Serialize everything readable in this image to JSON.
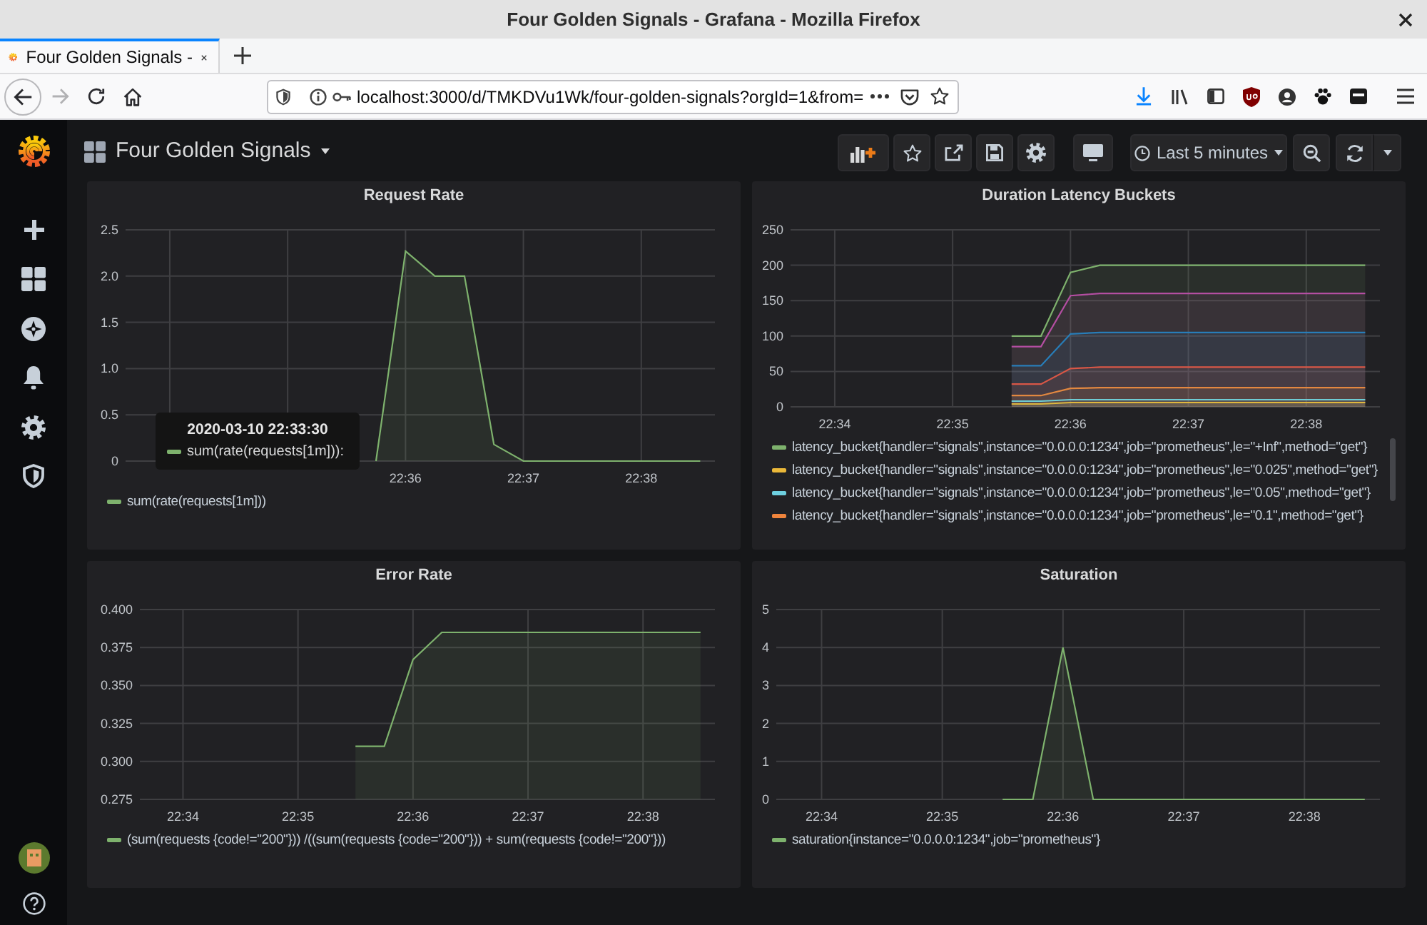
{
  "window": {
    "title": "Four Golden Signals - Grafana - Mozilla Firefox"
  },
  "browser": {
    "tabs": [
      {
        "label": "Four Golden Signals -",
        "selected": true
      }
    ],
    "forward_disabled": true,
    "url": "localhost:3000/d/TMKDVu1Wk/four-golden-signals?orgId=1&from="
  },
  "dashboard": {
    "title": "Four Golden Signals",
    "time_range": "Last 5 minutes"
  },
  "panels": [
    {
      "chart_data": {
        "type": "area",
        "title": "Request Rate",
        "grid": true,
        "categories": [
          null,
          null,
          null,
          null,
          null,
          null,
          null,
          null,
          null,
          "22:36",
          null,
          null,
          null,
          "22:37",
          null,
          null,
          null,
          "22:38",
          null,
          null
        ],
        "series": [
          {
            "name": "sum(rate(requests[1m]))",
            "color": "#7eb26d",
            "values": [
              null,
              null,
              null,
              null,
              null,
              null,
              null,
              null,
              0,
              2.27,
              2,
              2,
              0.18,
              0,
              0,
              0,
              0,
              0,
              0,
              0
            ]
          }
        ],
        "ylim": [
          0,
          2.5
        ],
        "yticks": [
          0,
          0.5,
          {
            "value": 1,
            "label": "1.0"
          },
          1.5,
          {
            "value": 2,
            "label": "2.0"
          },
          2.5
        ]
      },
      "tooltip": {
        "time": "2020-03-10 22:33:30",
        "items": [
          "sum(rate(requests[1m])):"
        ]
      }
    },
    {
      "chart_data": {
        "type": "area",
        "title": "Duration Latency Buckets",
        "grid": true,
        "categories": [
          null,
          "22:34",
          null,
          null,
          null,
          "22:35",
          null,
          null,
          null,
          "22:36",
          null,
          null,
          null,
          "22:37",
          null,
          null,
          null,
          "22:38",
          null,
          null
        ],
        "series": [
          {
            "name": "latency_bucket{handler=\"signals\",instance=\"0.0.0.0:1234\",job=\"prometheus\",le=\"+Inf\",method=\"get\"}",
            "color": "#7eb26d",
            "values": [
              null,
              null,
              null,
              null,
              null,
              null,
              null,
              100,
              100,
              190,
              200,
              200,
              200,
              200,
              200,
              200,
              200,
              200,
              200,
              200
            ]
          },
          {
            "name": "latency_bucket{handler=\"signals\",instance=\"0.0.0.0:1234\",job=\"prometheus\",le=\"0.025\",method=\"get\"}",
            "color": "#eab839",
            "values": [
              null,
              null,
              null,
              null,
              null,
              null,
              null,
              4,
              4,
              6,
              6,
              6,
              6,
              6,
              6,
              6,
              6,
              6,
              6,
              6
            ]
          },
          {
            "name": "latency_bucket{handler=\"signals\",instance=\"0.0.0.0:1234\",job=\"prometheus\",le=\"0.05\",method=\"get\"}",
            "color": "#6ed0e0",
            "values": [
              null,
              null,
              null,
              null,
              null,
              null,
              null,
              8,
              8,
              10,
              10,
              10,
              10,
              10,
              10,
              10,
              10,
              10,
              10,
              10
            ]
          },
          {
            "name": "latency_bucket{handler=\"signals\",instance=\"0.0.0.0:1234\",job=\"prometheus\",le=\"0.1\",method=\"get\"}",
            "color": "#ef843c",
            "values": [
              null,
              null,
              null,
              null,
              null,
              null,
              null,
              16,
              16,
              26,
              27,
              27,
              27,
              27,
              27,
              27,
              27,
              27,
              27,
              27
            ]
          },
          {
            "color": "#e24d42",
            "values": [
              null,
              null,
              null,
              null,
              null,
              null,
              null,
              32,
              32,
              54,
              56,
              56,
              56,
              56,
              56,
              56,
              56,
              56,
              56,
              56
            ]
          },
          {
            "color": "#1f78c1",
            "values": [
              null,
              null,
              null,
              null,
              null,
              null,
              null,
              58,
              58,
              103,
              105,
              105,
              105,
              105,
              105,
              105,
              105,
              105,
              105,
              105
            ]
          },
          {
            "color": "#ba43a9",
            "values": [
              null,
              null,
              null,
              null,
              null,
              null,
              null,
              85,
              85,
              157,
              160,
              160,
              160,
              160,
              160,
              160,
              160,
              160,
              160,
              160
            ]
          }
        ],
        "ylim": [
          0,
          250
        ],
        "yticks": [
          0,
          50,
          100,
          150,
          200,
          250
        ]
      }
    },
    {
      "chart_data": {
        "type": "area",
        "title": "Error Rate",
        "grid": true,
        "categories": [
          null,
          "22:34",
          null,
          null,
          null,
          "22:35",
          null,
          null,
          null,
          "22:36",
          null,
          null,
          null,
          "22:37",
          null,
          null,
          null,
          "22:38",
          null,
          null
        ],
        "series": [
          {
            "name": "(sum(requests {code!=\"200\"})) /((sum(requests {code=\"200\"})) + sum(requests {code!=\"200\"}))",
            "color": "#7eb26d",
            "values": [
              null,
              null,
              null,
              null,
              null,
              null,
              null,
              0.31,
              0.31,
              0.367,
              0.385,
              0.385,
              0.385,
              0.385,
              0.385,
              0.385,
              0.385,
              0.385,
              0.385,
              0.385
            ]
          }
        ],
        "ylim": [
          0.275,
          0.4
        ],
        "yticks": [
          {
            "value": 0.275,
            "label": "0.275"
          },
          {
            "value": 0.3,
            "label": "0.300"
          },
          {
            "value": 0.325,
            "label": "0.325"
          },
          {
            "value": 0.35,
            "label": "0.350"
          },
          {
            "value": 0.375,
            "label": "0.375"
          },
          {
            "value": 0.4,
            "label": "0.400"
          }
        ]
      }
    },
    {
      "chart_data": {
        "type": "area",
        "title": "Saturation",
        "grid": true,
        "categories": [
          null,
          "22:34",
          null,
          null,
          null,
          "22:35",
          null,
          null,
          null,
          "22:36",
          null,
          null,
          null,
          "22:37",
          null,
          null,
          null,
          "22:38",
          null,
          null
        ],
        "series": [
          {
            "name": "saturation{instance=\"0.0.0.0:1234\",job=\"prometheus\"}",
            "color": "#7eb26d",
            "values": [
              null,
              null,
              null,
              null,
              null,
              null,
              null,
              0,
              0,
              4,
              0,
              0,
              0,
              0,
              0,
              0,
              0,
              0,
              0,
              0
            ]
          }
        ],
        "ylim": [
          0,
          5
        ],
        "yticks": [
          0,
          1,
          2,
          3,
          4,
          5
        ]
      }
    }
  ]
}
